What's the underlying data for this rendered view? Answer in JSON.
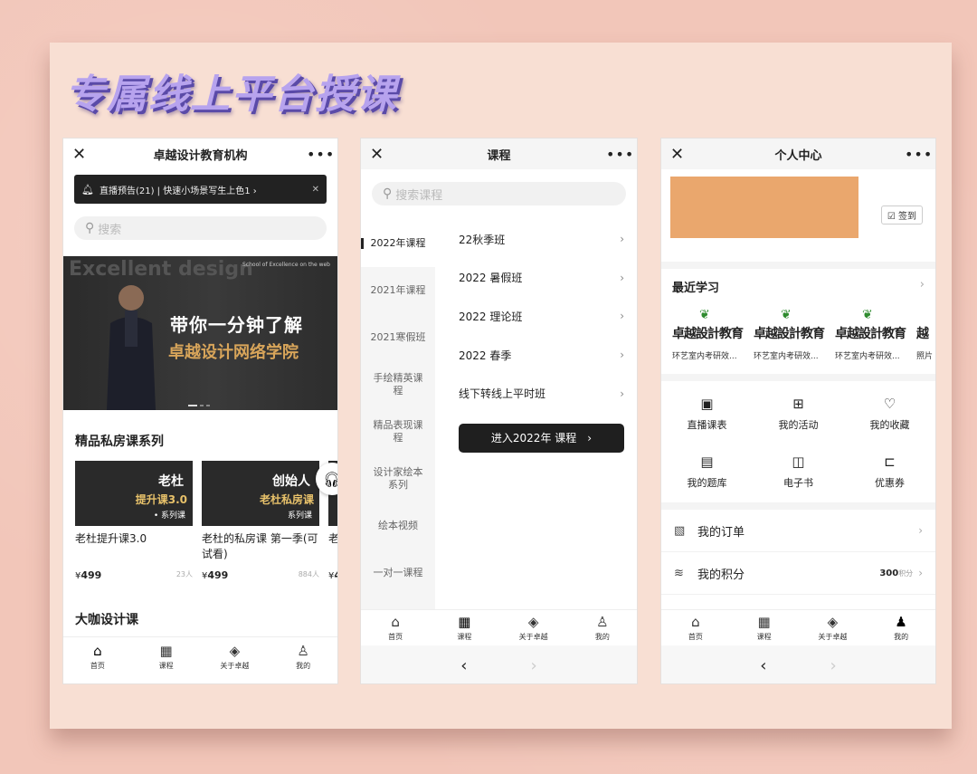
{
  "headline": "专属线上平台授课",
  "phone1": {
    "title": "卓越设计教育机构",
    "close_icon": "close-icon",
    "more_icon": "more-icon",
    "notice": "直播预告(21) | 快速小场景写生上色1",
    "search_placeholder": "搜索",
    "banner": {
      "ghost": "Excellent design",
      "tiny": "School of Excellence on the web",
      "line1": "带你一分钟了解",
      "line2": "卓越设计网络学院"
    },
    "section1": "精品私房课系列",
    "courses": [
      {
        "thumb_title": "老杜",
        "thumb_sub": "提升课3.0",
        "thumb_tag": "• 系列课",
        "name": "老杜提升课3.0",
        "price_symbol": "¥",
        "price": "499",
        "count": "23人"
      },
      {
        "thumb_title": "创始人",
        "thumb_sub": "老杜私房课",
        "thumb_tag": "系列课",
        "name": "老杜的私房课 第一季(可试看)",
        "price_symbol": "¥",
        "price": "499",
        "count": "884人"
      },
      {
        "thumb_title": "",
        "thumb_sub": "",
        "thumb_tag": "",
        "name": "老季",
        "price_symbol": "¥",
        "price": "4",
        "count": ""
      }
    ],
    "section2": "大咖设计课",
    "tabs": [
      {
        "label": "首页",
        "icon": "home-icon",
        "glyph": "⌂"
      },
      {
        "label": "课程",
        "icon": "grid-icon",
        "glyph": "▦"
      },
      {
        "label": "关于卓越",
        "icon": "layers-icon",
        "glyph": "◈"
      },
      {
        "label": "我的",
        "icon": "user-icon",
        "glyph": "♙"
      }
    ]
  },
  "phone2": {
    "title": "课程",
    "search_placeholder": "搜索课程",
    "categories": [
      "2022年课程",
      "2021年课程",
      "2021寒假班",
      "手绘精英课程",
      "精品表现课程",
      "设计家绘本系列",
      "绘本视频",
      "一对一课程"
    ],
    "items": [
      "22秋季班",
      "2022 暑假班",
      "2022 理论班",
      "2022 春季",
      "线下转线上平时班"
    ],
    "enter_button": "进入2022年 课程",
    "tabs": [
      {
        "label": "首页",
        "icon": "home-icon",
        "glyph": "⌂"
      },
      {
        "label": "课程",
        "icon": "grid-icon",
        "glyph": "▦"
      },
      {
        "label": "关于卓越",
        "icon": "layers-icon",
        "glyph": "◈"
      },
      {
        "label": "我的",
        "icon": "user-icon",
        "glyph": "♙"
      }
    ],
    "nav_back": "‹",
    "nav_forward": "›"
  },
  "phone3": {
    "title": "个人中心",
    "signin": "签到",
    "recent_title": "最近学习",
    "recents": [
      {
        "brand": "卓越設計教育",
        "caption": "环艺室内考研效..."
      },
      {
        "brand": "卓越設計教育",
        "caption": "环艺室内考研效..."
      },
      {
        "brand": "卓越設計教育",
        "caption": "环艺室内考研效..."
      },
      {
        "brand": "越",
        "caption": "照片"
      }
    ],
    "grid": [
      {
        "label": "直播课表",
        "icon": "calendar-icon",
        "glyph": "▣"
      },
      {
        "label": "我的活动",
        "icon": "apps-icon",
        "glyph": "⊞"
      },
      {
        "label": "我的收藏",
        "icon": "heart-icon",
        "glyph": "♡"
      },
      {
        "label": "我的题库",
        "icon": "notebook-icon",
        "glyph": "▤"
      },
      {
        "label": "电子书",
        "icon": "book-icon",
        "glyph": "◫"
      },
      {
        "label": "优惠券",
        "icon": "coupon-icon",
        "glyph": "⊏"
      }
    ],
    "rows": [
      {
        "label": "我的订单",
        "icon": "order-icon",
        "glyph": "▧",
        "value": "",
        "unit": ""
      },
      {
        "label": "我的积分",
        "icon": "points-icon",
        "glyph": "≋",
        "value": "300",
        "unit": "积分"
      }
    ],
    "tabs": [
      {
        "label": "首页",
        "icon": "home-icon",
        "glyph": "⌂"
      },
      {
        "label": "课程",
        "icon": "grid-icon",
        "glyph": "▦"
      },
      {
        "label": "关于卓越",
        "icon": "layers-icon",
        "glyph": "◈"
      },
      {
        "label": "我的",
        "icon": "user-icon",
        "glyph": "♟"
      }
    ],
    "nav_back": "‹",
    "nav_forward": "›"
  },
  "colors": {
    "background": "#f2c6b9",
    "card": "#f8dfd3",
    "avatar_box": "#eaa76d",
    "headline": "#b7a3ee"
  }
}
